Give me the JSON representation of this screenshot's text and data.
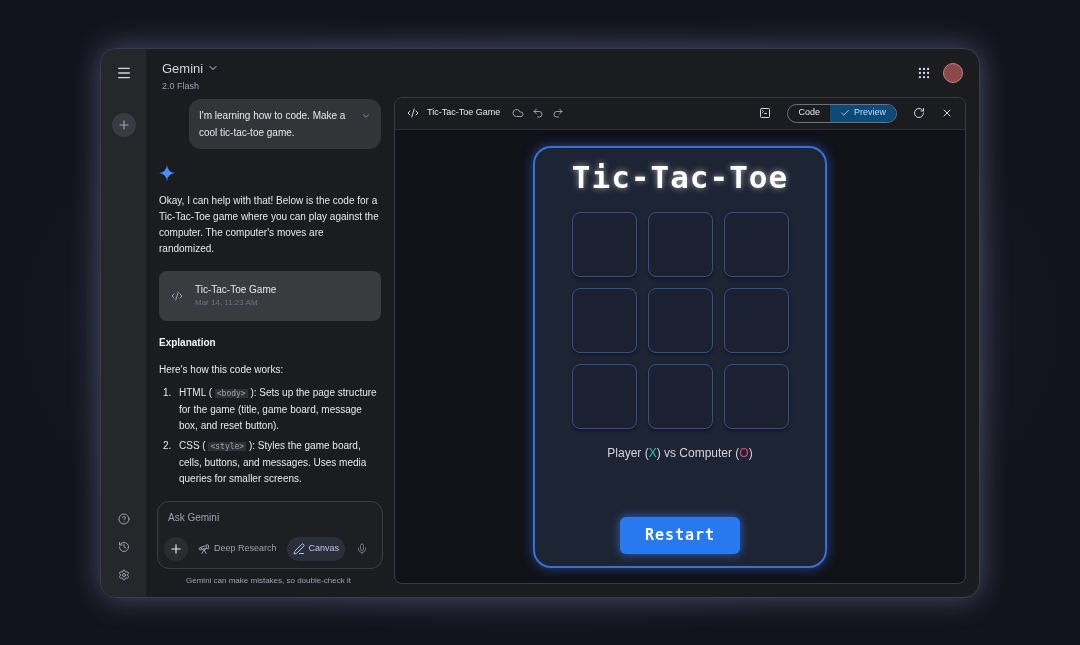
{
  "header": {
    "title": "Gemini",
    "model": "2.0 Flash"
  },
  "user_message": "I'm learning how to code. Make a cool tic-tac-toe game.",
  "response": {
    "intro": "Okay, I can help with that! Below is the code for a Tic-Tac-Toe game where you can play against the computer. The computer's moves are randomized.",
    "doc_card": {
      "title": "Tic-Tac-Toe Game",
      "date": "Mar 14, 11:23 AM"
    },
    "heading": "Explanation",
    "lead": "Here's how this code works:",
    "list": [
      {
        "number": "1.",
        "parts": [
          {
            "kind": "text",
            "text": "HTML ( "
          },
          {
            "kind": "code",
            "text": "<body>"
          },
          {
            "kind": "text",
            "text": " ): Sets up the page structure for the game (title, game board, message box, and reset button)."
          }
        ]
      },
      {
        "number": "2.",
        "parts": [
          {
            "kind": "text",
            "text": "CSS ( "
          },
          {
            "kind": "code",
            "text": "<style>"
          },
          {
            "kind": "text",
            "text": " ): Styles the game board, cells, buttons, and messages. Uses media queries for smaller screens."
          }
        ]
      }
    ]
  },
  "input": {
    "placeholder": "Ask Gemini",
    "tools": [
      {
        "label": "Deep Research",
        "selected": false
      },
      {
        "label": "Canvas",
        "selected": true
      }
    ]
  },
  "disclaimer": "Gemini can make mistakes, so double-check it",
  "canvas": {
    "title": "Tic-Tac-Toe Game",
    "tabs": [
      {
        "label": "Code",
        "selected": false
      },
      {
        "label": "Preview",
        "selected": true
      }
    ],
    "game": {
      "title": "Tic-Tac-Toe",
      "cells": [
        {
          "kind": "empty"
        },
        {
          "kind": "empty"
        },
        {
          "kind": "empty"
        },
        {
          "kind": "empty"
        },
        {
          "kind": "empty"
        },
        {
          "kind": "empty"
        },
        {
          "kind": "empty"
        },
        {
          "kind": "empty"
        },
        {
          "kind": "empty"
        }
      ],
      "status": [
        {
          "kind": "plain",
          "text": "Player ("
        },
        {
          "kind": "player",
          "text": "X"
        },
        {
          "kind": "plain",
          "text": ") vs Computer ("
        },
        {
          "kind": "computer",
          "text": "O"
        },
        {
          "kind": "plain",
          "text": ")"
        }
      ],
      "button": "Restart"
    }
  }
}
